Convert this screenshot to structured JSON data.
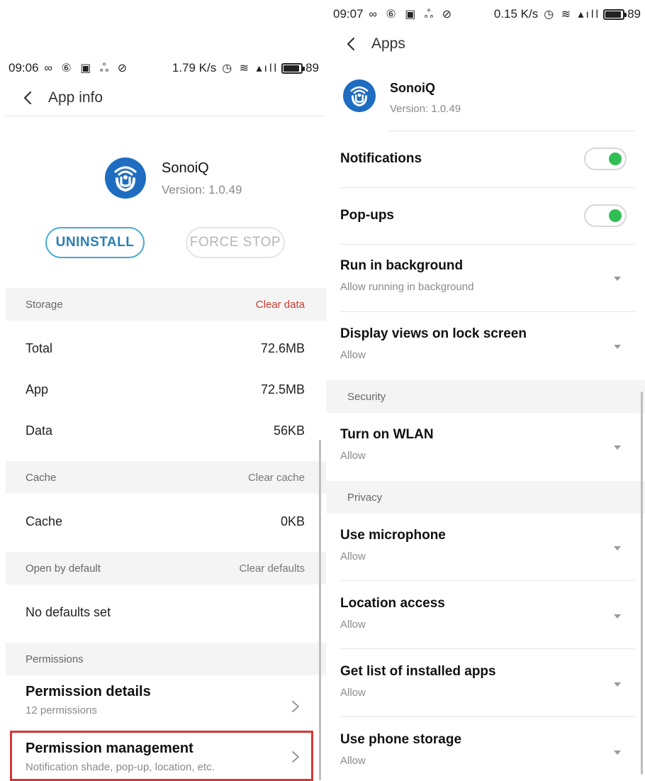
{
  "left": {
    "status": {
      "time": "09:06",
      "icons": "∞ ⑥ ▣ ஃ ⊘",
      "speed": "1.79 K/s",
      "right_icons": "◷ ≋ ▴ıll",
      "battery": "89"
    },
    "topbar": {
      "title": "App info"
    },
    "app": {
      "name": "SonoiQ",
      "version": "Version: 1.0.49"
    },
    "buttons": {
      "uninstall": "UNINSTALL",
      "force_stop": "FORCE STOP"
    },
    "storage": {
      "header": "Storage",
      "action": "Clear data",
      "rows": [
        {
          "label": "Total",
          "value": "72.6MB"
        },
        {
          "label": "App",
          "value": "72.5MB"
        },
        {
          "label": "Data",
          "value": "56KB"
        }
      ]
    },
    "cache": {
      "header": "Cache",
      "action": "Clear cache",
      "row": {
        "label": "Cache",
        "value": "0KB"
      }
    },
    "open_default": {
      "header": "Open by default",
      "action": "Clear defaults",
      "row": "No defaults set"
    },
    "permissions": {
      "header": "Permissions",
      "details": {
        "title": "Permission details",
        "subtitle": "12 permissions"
      },
      "management": {
        "title": "Permission management",
        "subtitle": "Notification shade, pop-up, location, etc."
      }
    },
    "colors": {
      "accent": "#45a9d4",
      "danger": "#c93b33",
      "highlight": "#d73636"
    }
  },
  "right": {
    "status": {
      "time": "09:07",
      "icons": "∞ ⑥ ▣ ஃ ⊘",
      "speed": "0.15 K/s",
      "right_icons": "◷ ≋ ▴ıll",
      "battery": "89"
    },
    "topbar": {
      "title": "Apps"
    },
    "app": {
      "name": "SonoiQ",
      "version": "Version: 1.0.49"
    },
    "toggles": [
      {
        "label": "Notifications",
        "on": true
      },
      {
        "label": "Pop-ups",
        "on": true
      }
    ],
    "items_general": [
      {
        "title": "Run in background",
        "subtitle": "Allow running in background"
      },
      {
        "title": "Display views on lock screen",
        "subtitle": "Allow"
      }
    ],
    "security": {
      "header": "Security",
      "items": [
        {
          "title": "Turn on WLAN",
          "subtitle": "Allow"
        }
      ]
    },
    "privacy": {
      "header": "Privacy",
      "items": [
        {
          "title": "Use microphone",
          "subtitle": "Allow"
        },
        {
          "title": "Location access",
          "subtitle": "Allow"
        },
        {
          "title": "Get list of installed apps",
          "subtitle": "Allow"
        },
        {
          "title": "Use phone storage",
          "subtitle": "Allow"
        }
      ]
    },
    "colors": {
      "toggle_on": "#2fbd54"
    }
  }
}
